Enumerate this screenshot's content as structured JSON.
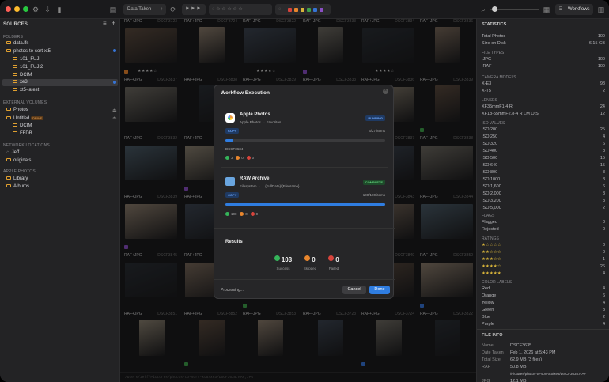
{
  "toolbar": {
    "sort_label": "Data Taken",
    "workflows_label": "Workflows"
  },
  "sidebar": {
    "sources_header": "SOURCES",
    "folders_header": "FOLDERS",
    "folders": [
      {
        "label": "data.lfs"
      },
      {
        "label": "photos-to-sort-xt5"
      },
      {
        "label": "101_FUJI"
      },
      {
        "label": "101_FUJI2"
      },
      {
        "label": "DCIM"
      },
      {
        "label": "xe3"
      },
      {
        "label": "xt5-latest"
      }
    ],
    "external_header": "EXTERNAL VOLUMES",
    "external": [
      {
        "label": "Photos"
      },
      {
        "label": "Untitled",
        "badge": "DRIVE"
      },
      {
        "label": "DCIM"
      },
      {
        "label": "FFDB"
      }
    ],
    "network_header": "NETWORK LOCATIONS",
    "network": [
      {
        "label": "Jeff"
      },
      {
        "label": "originals"
      }
    ],
    "apple_header": "APPLE PHOTOS",
    "apple": [
      {
        "label": "Library"
      },
      {
        "label": "Albums"
      }
    ]
  },
  "grid": {
    "cell_label": "RAF+JPG",
    "names": [
      "DSCF3723",
      "DSCF3724",
      "DSCF3822",
      "DSCF3833",
      "DSCF3834",
      "DSCF3836",
      "DSCF3837",
      "DSCF3838",
      "DSCF3839",
      "DSCF3833",
      "DSCF3836",
      "DSCF3839",
      "DSCF3832",
      "DSCF3834",
      "DSCF3835",
      "DSCF3836",
      "DSCF3837",
      "DSCF3838",
      "DSCF3839",
      "DSCF3840",
      "DSCF3841",
      "DSCF3842",
      "DSCF3843",
      "DSCF3844",
      "DSCF3845",
      "DSCF3846",
      "DSCF3847",
      "DSCF3848",
      "DSCF3849",
      "DSCF3850",
      "DSCF3851",
      "DSCF3852",
      "DSCF3853"
    ]
  },
  "modal": {
    "title": "Workflow Execution",
    "job1": {
      "name": "Apple Photos",
      "sub": "Apple Photos → Favorites",
      "status": "RUNNING",
      "tag": "COPY",
      "count": "3/27 items",
      "file": "DSCF3634",
      "progress": 0.05,
      "ok": "3",
      "skip": "0",
      "fail": "0"
    },
    "job2": {
      "name": "RAW Archive",
      "sub": "Filesystem → ...{FullDate}/{FileName}",
      "status": "COMPLETE",
      "tag": "COPY",
      "count": "100/100 items",
      "progress": 1,
      "ok": "100",
      "skip": "0",
      "fail": "0"
    },
    "results_title": "Results",
    "success": "103",
    "success_label": "Success",
    "skipped": "0",
    "skipped_label": "Skipped",
    "failed": "0",
    "failed_label": "Failed",
    "processing": "Processing...",
    "cancel": "Cancel",
    "done": "Done"
  },
  "stats": {
    "header": "STATISTICS",
    "total_label": "Total Photos",
    "total": "100",
    "size_label": "Size on Disk",
    "size": "6.15 GB",
    "filetypes_header": "FILE TYPES",
    "filetypes": [
      {
        "k": ".JPG",
        "v": "100"
      },
      {
        "k": ".RAF",
        "v": "100"
      }
    ],
    "camera_header": "CAMERA MODELS",
    "cameras": [
      {
        "k": "X-E3",
        "v": "98"
      },
      {
        "k": "X-T5",
        "v": "2"
      }
    ],
    "lenses_header": "LENSES",
    "lenses": [
      {
        "k": "XF35mmF1.4 R",
        "v": "24"
      },
      {
        "k": "XF18-55mmF2.8-4 R LM OIS",
        "v": "12"
      }
    ],
    "iso_header": "ISO VALUES",
    "iso": [
      {
        "k": "ISO 200",
        "v": "25"
      },
      {
        "k": "ISO 250",
        "v": "4"
      },
      {
        "k": "ISO 320",
        "v": "6"
      },
      {
        "k": "ISO 400",
        "v": "8"
      },
      {
        "k": "ISO 500",
        "v": "15"
      },
      {
        "k": "ISO 640",
        "v": "15"
      },
      {
        "k": "ISO 800",
        "v": "3"
      },
      {
        "k": "ISO 1000",
        "v": "3"
      },
      {
        "k": "ISO 1,600",
        "v": "6"
      },
      {
        "k": "ISO 2,000",
        "v": "3"
      },
      {
        "k": "ISO 3,200",
        "v": "3"
      },
      {
        "k": "ISO 5,000",
        "v": "2"
      }
    ],
    "flags_header": "FLAGS",
    "flags": [
      {
        "k": "Flagged",
        "v": "0"
      },
      {
        "k": "Rejected",
        "v": "0"
      }
    ],
    "ratings_header": "RATINGS",
    "ratings": [
      {
        "k": "★☆☆☆☆",
        "v": "0"
      },
      {
        "k": "★★☆☆☆",
        "v": "0"
      },
      {
        "k": "★★★☆☆",
        "v": "1"
      },
      {
        "k": "★★★★☆",
        "v": "26"
      },
      {
        "k": "★★★★★",
        "v": "4"
      }
    ],
    "colors_header": "COLOR LABELS",
    "colors": [
      {
        "k": "Red",
        "v": "4",
        "c": "#d8443c"
      },
      {
        "k": "Orange",
        "v": "6",
        "c": "#e9862d"
      },
      {
        "k": "Yellow",
        "v": "4",
        "c": "#d8b43a"
      },
      {
        "k": "Green",
        "v": "3",
        "c": "#3fa14a"
      },
      {
        "k": "Blue",
        "v": "2",
        "c": "#3674d6"
      },
      {
        "k": "Purple",
        "v": "4",
        "c": "#8a4fc4"
      }
    ],
    "fileinfo_header": "FILE INFO",
    "info": [
      {
        "k": "Name",
        "v": "DSCF3635"
      },
      {
        "k": "Date Taken",
        "v": "Feb 1, 2026 at 5:43 PM"
      },
      {
        "k": "Total Size",
        "v": "62.9 MB (3 files)"
      },
      {
        "k": "RAF",
        "v": "50.8 MB"
      },
      {
        "k": "",
        "v": "/Pictures/photos-to-sort-xt5/xe3/DSCF3635.RAF"
      },
      {
        "k": "JPG",
        "v": "12.1 MB"
      }
    ]
  },
  "pathbar": "/Users/Jeff/Pictures/photos-to-sort-xt5/xe3/DSCF3635.RAF,JPG"
}
